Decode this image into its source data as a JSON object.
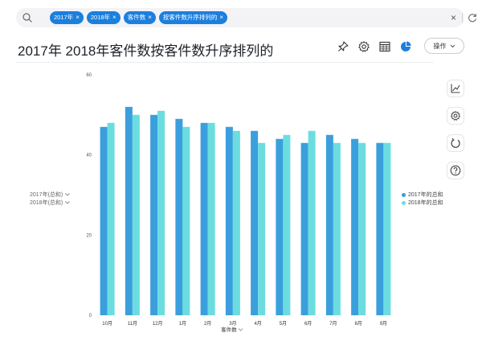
{
  "search": {
    "chips": [
      "2017年",
      "2018年",
      "客件数",
      "按客件数升序排列的"
    ],
    "clear_glyph": "×",
    "search_icon": "search-icon",
    "refresh_icon": "refresh-icon"
  },
  "header": {
    "title": "2017年 2018年客件数按客件数升序排列的",
    "icons": [
      "pin-icon",
      "gear-icon",
      "table-icon",
      "pie-chart-icon"
    ],
    "action_label": "操作"
  },
  "rail": {
    "icons": [
      "trend-chart-icon",
      "settings-icon",
      "reload-icon",
      "help-icon"
    ]
  },
  "colors": {
    "series_2017": "#3a9fdc",
    "series_2018": "#6bdde0",
    "chip": "#1b7fde"
  },
  "chart_data": {
    "type": "bar",
    "categories": [
      "10月",
      "11月",
      "12月",
      "1月",
      "2月",
      "3月",
      "4月",
      "5月",
      "6月",
      "7月",
      "8月",
      "9月"
    ],
    "series": [
      {
        "name": "2017年的总和",
        "values": [
          47,
          52,
          50,
          49,
          48,
          47,
          46,
          44,
          43,
          45,
          44,
          43
        ]
      },
      {
        "name": "2018年的总和",
        "values": [
          48,
          50,
          51,
          47,
          48,
          46,
          43,
          45,
          46,
          43,
          43,
          43
        ]
      }
    ],
    "xlabel": "客件数",
    "ylabels": [
      "2017年(总和)",
      "2018年(总和)"
    ],
    "yticks": [
      0,
      20,
      40,
      60
    ],
    "ylim": [
      0,
      60
    ],
    "legend_position": "right",
    "grid": false
  }
}
